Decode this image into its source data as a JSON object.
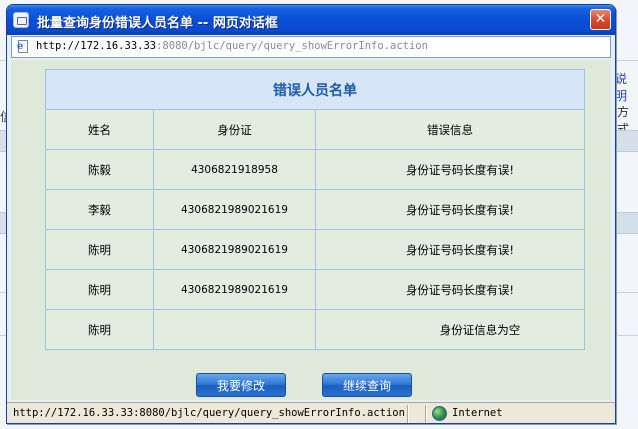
{
  "background": {
    "snippets": [
      "说明",
      "方式",
      "信息"
    ]
  },
  "dialog": {
    "title": "批量查询身份错误人员名单 -- 网页对话框",
    "close_label": "✕",
    "address": {
      "host": "http://172.16.33.33",
      "path": ":8080/bjlc/query/query_showErrorInfo.action"
    },
    "table": {
      "caption": "错误人员名单",
      "headers": {
        "name": "姓名",
        "id": "身份证",
        "error": "错误信息"
      },
      "rows": [
        {
          "name": "陈毅",
          "id": "4306821918958",
          "error": "身份证号码长度有误!"
        },
        {
          "name": "李毅",
          "id": "4306821989021619",
          "error": "身份证号码长度有误!"
        },
        {
          "name": "陈明",
          "id": "4306821989021619",
          "error": "身份证号码长度有误!"
        },
        {
          "name": "陈明",
          "id": "4306821989021619",
          "error": "身份证号码长度有误!"
        },
        {
          "name": "陈明",
          "id": "",
          "error": "身份证信息为空"
        }
      ]
    },
    "buttons": {
      "edit": "我要修改",
      "continue": "继续查询"
    },
    "status": {
      "url": "http://172.16.33.33:8080/bjlc/query/query_showErrorInfo.action",
      "zone": "Internet"
    }
  }
}
